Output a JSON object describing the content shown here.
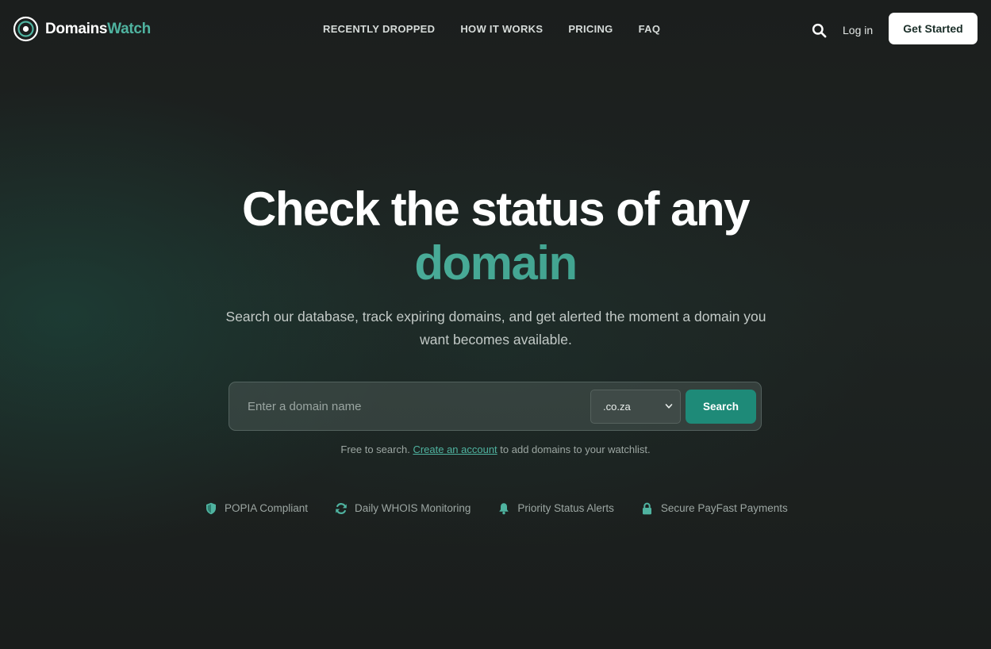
{
  "brand": {
    "name_main": "Domains",
    "name_accent": "Watch"
  },
  "nav": {
    "links": [
      {
        "label": "RECENTLY DROPPED"
      },
      {
        "label": "HOW IT WORKS"
      },
      {
        "label": "PRICING"
      },
      {
        "label": "FAQ"
      }
    ],
    "login_label": "Log in",
    "cta_label": "Get Started"
  },
  "hero": {
    "title_line1": "Check the status of any",
    "title_line2": "domain",
    "subtitle": "Search our database, track expiring domains, and get alerted the moment a domain you want becomes available."
  },
  "search": {
    "placeholder": "Enter a domain name",
    "value": "",
    "tld_selected": ".co.za",
    "button_label": "Search"
  },
  "note": {
    "prefix": "Free to search. ",
    "link_label": "Create an account",
    "suffix": " to add domains to your watchlist."
  },
  "features": [
    {
      "icon": "shield-icon",
      "label": "POPIA Compliant"
    },
    {
      "icon": "refresh-icon",
      "label": "Daily WHOIS Monitoring"
    },
    {
      "icon": "bell-icon",
      "label": "Priority Status Alerts"
    },
    {
      "icon": "lock-icon",
      "label": "Secure PayFast Payments"
    }
  ],
  "colors": {
    "accent": "#4fb3a0",
    "button_primary": "#1e8a78",
    "background": "#1c201f"
  }
}
